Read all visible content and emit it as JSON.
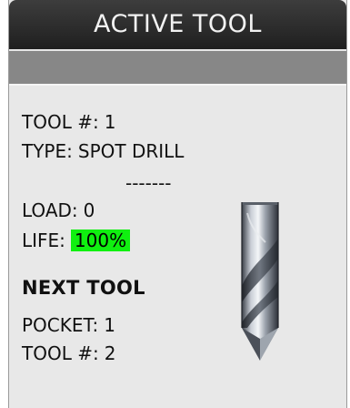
{
  "title": "ACTIVE TOOL",
  "tool": {
    "number_label": "TOOL #:",
    "number_value": "1",
    "type_label": "TYPE:",
    "type_value": "SPOT DRILL",
    "divider": "-------",
    "load_label": "LOAD:",
    "load_value": "0",
    "life_label": "LIFE:",
    "life_value": "100%",
    "life_color": "#10f010"
  },
  "next_tool": {
    "heading": "NEXT TOOL",
    "pocket_label": "POCKET:",
    "pocket_value": "1",
    "number_label": "TOOL #:",
    "number_value": "2"
  },
  "icons": {
    "tool_image": "spot-drill-icon"
  }
}
